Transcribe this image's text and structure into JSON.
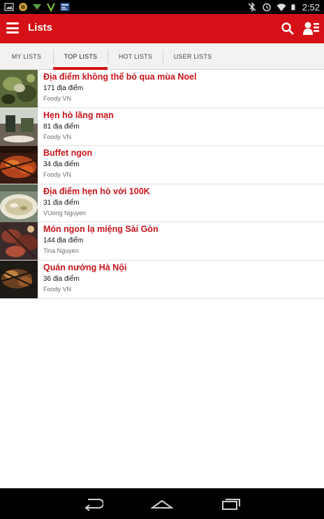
{
  "status_bar": {
    "time": "2:52",
    "left_icons": [
      "image-notification-icon",
      "coin-notification-icon",
      "download-notification-icon",
      "v-app-icon",
      "news-app-icon"
    ],
    "right_icons": [
      "bluetooth-off-icon",
      "alarm-icon",
      "wifi-icon",
      "battery-icon"
    ]
  },
  "app_bar": {
    "title": "Lists",
    "color": "#d51016",
    "icons": [
      "menu-icon",
      "search-icon",
      "profile-icon"
    ]
  },
  "tabs": [
    {
      "label": "MY LISTS",
      "active": false
    },
    {
      "label": "TOP LISTS",
      "active": true
    },
    {
      "label": "HOT LISTS",
      "active": false
    },
    {
      "label": "USER LISTS",
      "active": false
    }
  ],
  "lists": [
    {
      "title": "Địa điểm không thể bỏ qua mùa Noel",
      "count": "171 địa điểm",
      "author": "Foody VN"
    },
    {
      "title": "Hẹn hò lãng mạn",
      "count": "81 địa điểm",
      "author": "Foody VN"
    },
    {
      "title": "Buffet ngon",
      "count": "34 địa điểm",
      "author": "Foody VN"
    },
    {
      "title": "Địa điểm hẹn hò với 100K",
      "count": "31 địa điểm",
      "author": "VUong Nguyen"
    },
    {
      "title": "Món ngon lạ miệng Sài Gòn",
      "count": "144 địa điểm",
      "author": "Tina Nguyen"
    },
    {
      "title": "Quán nướng Hà Nội",
      "count": "36 địa điểm",
      "author": "Foody VN"
    }
  ],
  "nav_bar": {
    "icons": [
      "back-icon",
      "home-icon",
      "recent-apps-icon"
    ]
  }
}
